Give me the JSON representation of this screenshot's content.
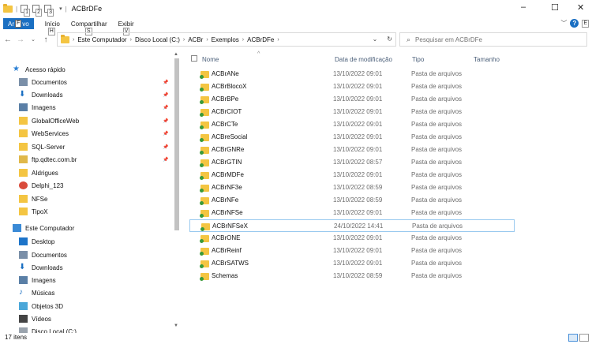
{
  "window": {
    "title": "ACBrDFe",
    "separator": "|",
    "controls": [
      "–",
      "☐",
      "✕"
    ]
  },
  "quick_access": {
    "keys": [
      "1",
      "2",
      "3"
    ]
  },
  "ribbon": {
    "file_prefix": "Ar",
    "file_key": "F",
    "file_suffix": "vo",
    "tabs": [
      {
        "label": "Início",
        "key": "H"
      },
      {
        "label": "Compartilhar",
        "key": "S"
      },
      {
        "label": "Exibir",
        "key": "V"
      }
    ],
    "help_key": "E"
  },
  "address": {
    "breadcrumbs": [
      "Este Computador",
      "Disco Local (C:)",
      "ACBr",
      "Exemplos",
      "ACBrDFe"
    ],
    "search_placeholder": "Pesquisar em ACBrDFe"
  },
  "navpane": {
    "items": [
      {
        "label": "Acesso rápido",
        "icon": "star-icon",
        "pinned": false
      },
      {
        "label": "Documentos",
        "icon": "document-icon",
        "pinned": true
      },
      {
        "label": "Downloads",
        "icon": "download-icon",
        "pinned": true
      },
      {
        "label": "Imagens",
        "icon": "image-icon",
        "pinned": true
      },
      {
        "label": "GlobalOfficeWeb",
        "icon": "folder-icon",
        "pinned": true
      },
      {
        "label": "WebServices",
        "icon": "folder-icon",
        "pinned": true
      },
      {
        "label": "SQL-Server",
        "icon": "folder-icon",
        "pinned": true
      },
      {
        "label": "ftp.qdtec.com.br",
        "icon": "network-icon",
        "pinned": true
      },
      {
        "label": "AIdrigues",
        "icon": "folder-icon",
        "pinned": false
      },
      {
        "label": "Delphi_123",
        "icon": "delphi-icon",
        "pinned": false
      },
      {
        "label": "NFSe",
        "icon": "folder-icon",
        "pinned": false
      },
      {
        "label": "TipoX",
        "icon": "folder-icon",
        "pinned": false
      },
      {
        "label": "Este Computador",
        "icon": "computer-icon",
        "pinned": false
      },
      {
        "label": "Desktop",
        "icon": "desktop-icon",
        "pinned": false
      },
      {
        "label": "Documentos",
        "icon": "document-icon",
        "pinned": false
      },
      {
        "label": "Downloads",
        "icon": "download-icon",
        "pinned": false
      },
      {
        "label": "Imagens",
        "icon": "image-icon",
        "pinned": false
      },
      {
        "label": "Músicas",
        "icon": "music-icon",
        "pinned": false
      },
      {
        "label": "Objetos 3D",
        "icon": "cube-icon",
        "pinned": false
      },
      {
        "label": "Vídeos",
        "icon": "video-icon",
        "pinned": false
      },
      {
        "label": "Disco Local (C:)",
        "icon": "drive-icon",
        "pinned": false
      }
    ]
  },
  "columns": {
    "name": "Nome",
    "date": "Data de modificação",
    "type": "Tipo",
    "size": "Tamanho"
  },
  "files": [
    {
      "name": "ACBrANe",
      "date": "13/10/2022 09:01",
      "type": "Pasta de arquivos"
    },
    {
      "name": "ACBrBlocoX",
      "date": "13/10/2022 09:01",
      "type": "Pasta de arquivos"
    },
    {
      "name": "ACBrBPe",
      "date": "13/10/2022 09:01",
      "type": "Pasta de arquivos"
    },
    {
      "name": "ACBrCIOT",
      "date": "13/10/2022 09:01",
      "type": "Pasta de arquivos"
    },
    {
      "name": "ACBrCTe",
      "date": "13/10/2022 09:01",
      "type": "Pasta de arquivos"
    },
    {
      "name": "ACBreSocial",
      "date": "13/10/2022 09:01",
      "type": "Pasta de arquivos"
    },
    {
      "name": "ACBrGNRe",
      "date": "13/10/2022 09:01",
      "type": "Pasta de arquivos"
    },
    {
      "name": "ACBrGTIN",
      "date": "13/10/2022 08:57",
      "type": "Pasta de arquivos"
    },
    {
      "name": "ACBrMDFe",
      "date": "13/10/2022 09:01",
      "type": "Pasta de arquivos"
    },
    {
      "name": "ACBrNF3e",
      "date": "13/10/2022 08:59",
      "type": "Pasta de arquivos"
    },
    {
      "name": "ACBrNFe",
      "date": "13/10/2022 08:59",
      "type": "Pasta de arquivos"
    },
    {
      "name": "ACBrNFSe",
      "date": "13/10/2022 09:01",
      "type": "Pasta de arquivos"
    },
    {
      "name": "ACBrNFSeX",
      "date": "24/10/2022 14:41",
      "type": "Pasta de arquivos",
      "selected": true
    },
    {
      "name": "ACBrONE",
      "date": "13/10/2022 09:01",
      "type": "Pasta de arquivos"
    },
    {
      "name": "ACBrReinf",
      "date": "13/10/2022 09:01",
      "type": "Pasta de arquivos"
    },
    {
      "name": "ACBrSATWS",
      "date": "13/10/2022 09:01",
      "type": "Pasta de arquivos"
    },
    {
      "name": "Schemas",
      "date": "13/10/2022 08:59",
      "type": "Pasta de arquivos"
    }
  ],
  "status": {
    "count": "17 itens"
  },
  "colors": {
    "accent": "#1a6fc2",
    "folder": "#f4c542",
    "selection_border": "#99c9ef",
    "header_text": "#4c607a"
  }
}
